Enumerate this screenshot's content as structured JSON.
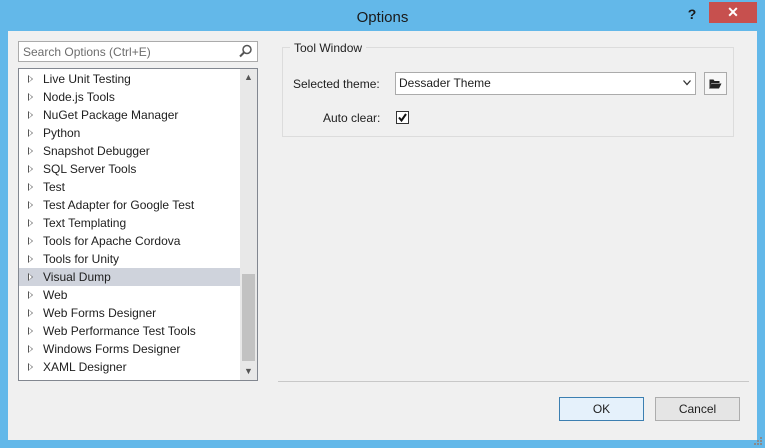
{
  "window": {
    "title": "Options",
    "help_label": "?",
    "close_label": "✕"
  },
  "search": {
    "placeholder": "Search Options (Ctrl+E)",
    "icon": "search-icon"
  },
  "tree": {
    "items": [
      {
        "label": "Live Unit Testing"
      },
      {
        "label": "Node.js Tools"
      },
      {
        "label": "NuGet Package Manager"
      },
      {
        "label": "Python"
      },
      {
        "label": "Snapshot Debugger"
      },
      {
        "label": "SQL Server Tools"
      },
      {
        "label": "Test"
      },
      {
        "label": "Test Adapter for Google Test"
      },
      {
        "label": "Text Templating"
      },
      {
        "label": "Tools for Apache Cordova"
      },
      {
        "label": "Tools for Unity"
      },
      {
        "label": "Visual Dump",
        "selected": true
      },
      {
        "label": "Web"
      },
      {
        "label": "Web Forms Designer"
      },
      {
        "label": "Web Performance Test Tools"
      },
      {
        "label": "Windows Forms Designer"
      },
      {
        "label": "XAML Designer"
      }
    ]
  },
  "panel": {
    "group_title": "Tool Window",
    "theme_label": "Selected theme:",
    "theme_value": "Dessader Theme",
    "auto_clear_label": "Auto clear:",
    "auto_clear_checked": true
  },
  "buttons": {
    "ok": "OK",
    "cancel": "Cancel"
  },
  "colors": {
    "titlebar": "#63b8e9",
    "close": "#c7504e",
    "selection": "#cfd3dc"
  }
}
